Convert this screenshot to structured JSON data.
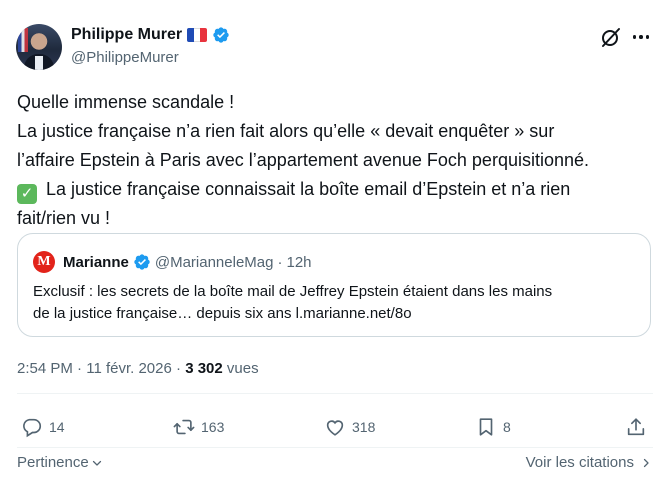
{
  "author": {
    "name": "Philippe Murer",
    "handle": "@PhilippeMurer",
    "flag_icon": "french-flag-icon",
    "verified_icon": "verified-badge-icon"
  },
  "header_buttons": {
    "grok_icon": "grok-icon",
    "more_icon": "more-options-icon"
  },
  "tweet": {
    "lines": [
      "Quelle immense scandale !",
      "La justice française n’a rien fait alors qu’elle « devait enquêter » sur",
      "l’affaire Epstein à Paris avec l’appartement avenue Foch perquisitionné.",
      "La justice française connaissait la boîte email d’Epstein et n’a rien",
      "fait/rien vu !"
    ],
    "check_emoji": "✓"
  },
  "quote": {
    "avatar_letter": "M",
    "name": "Marianne",
    "handle": "@MarianneleMag",
    "separator": "·",
    "time": "12h",
    "lines": [
      "Exclusif : les secrets de la boîte mail de Jeffrey Epstein étaient dans les mains",
      "de la justice française… depuis six ans l.marianne.net/8o"
    ]
  },
  "meta": {
    "time": "2:54 PM",
    "separator": "·",
    "date": "11 févr. 2026",
    "views_count": "3 302",
    "views_label": "vues"
  },
  "actions": {
    "replies": "14",
    "reposts": "163",
    "likes": "318",
    "bookmarks": "8"
  },
  "footer": {
    "sort_label": "Pertinence",
    "quotes_label": "Voir les citations"
  },
  "colors": {
    "text": "#0f1419",
    "secondary": "#536471",
    "verified": "#1d9bf0",
    "border": "#cfd9de"
  }
}
